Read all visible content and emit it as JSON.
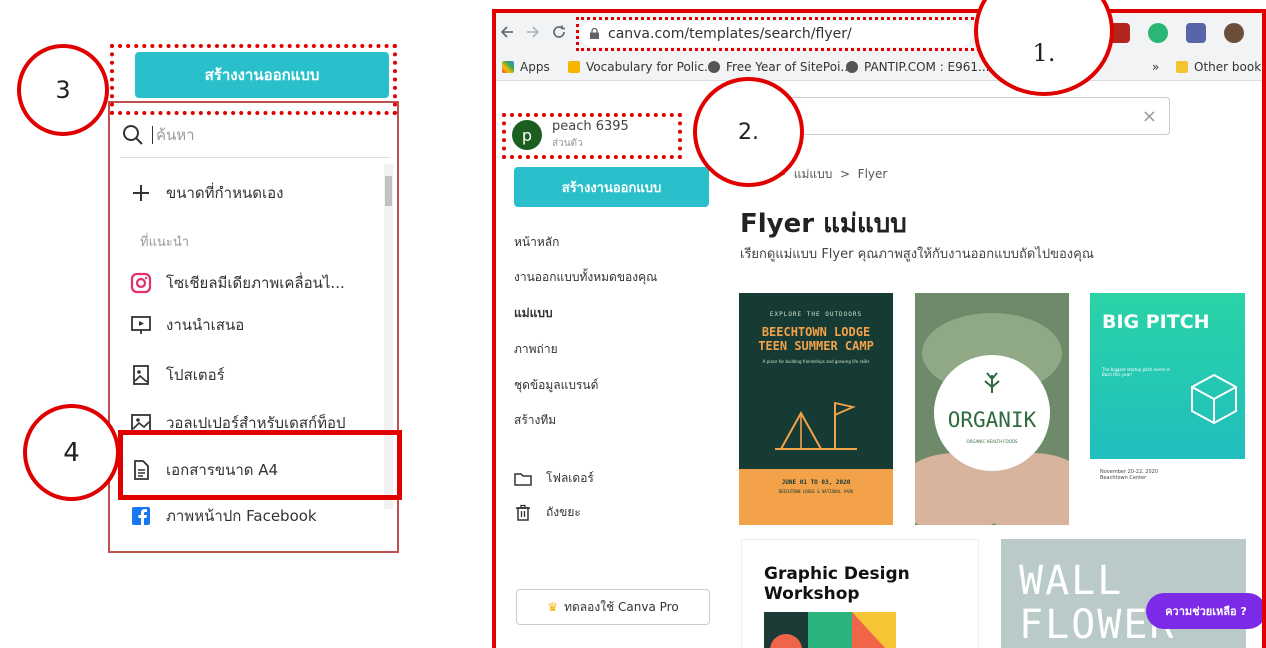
{
  "left_menu": {
    "create_label": "สร้างงานออกแบบ",
    "search_placeholder": "ค้นหา",
    "custom_size_label": "ขนาดที่กำหนดเอง",
    "suggested_heading": "ที่แนะนำ",
    "items": [
      {
        "label": "โซเชียลมีเดียภาพเคลื่อนไ...",
        "icon": "instagram-icon"
      },
      {
        "label": "งานนำเสนอ",
        "icon": "presentation-icon"
      },
      {
        "label": "โปสเตอร์",
        "icon": "poster-icon"
      },
      {
        "label": "วอลเปเปอร์สำหรับเดสก์ท็อป",
        "icon": "wallpaper-icon"
      },
      {
        "label": "เอกสารขนาด A4",
        "icon": "document-icon"
      },
      {
        "label": "ภาพหน้าปก Facebook",
        "icon": "facebook-icon"
      }
    ]
  },
  "annotations": {
    "step1": "1.",
    "step2": "2.",
    "step3": "3",
    "step4": "4"
  },
  "browser": {
    "url": "canva.com/templates/search/flyer/",
    "bookmarks": [
      {
        "label": "Apps"
      },
      {
        "label": "Vocabulary for Polic..."
      },
      {
        "label": "Free Year of SitePoi..."
      },
      {
        "label": "PANTIP.COM : E961..."
      },
      {
        "label": "»"
      },
      {
        "label": "Other bookmarks"
      }
    ]
  },
  "sidebar": {
    "user_initial": "p",
    "user_name": "peach 6395",
    "user_sub": "ส่วนตัว",
    "create_label": "สร้างงานออกแบบ",
    "links": [
      {
        "label": "หน้าหลัก"
      },
      {
        "label": "งานออกแบบทั้งหมดของคุณ"
      },
      {
        "label": "แม่แบบ"
      },
      {
        "label": "ภาพถ่าย"
      },
      {
        "label": "ชุดข้อมูลแบรนด์"
      },
      {
        "label": "สร้างทีม"
      }
    ],
    "folders_label": "โฟลเดอร์",
    "trash_label": "ถังขยะ",
    "pro_label": "ทดลองใช้ Canva Pro"
  },
  "main": {
    "breadcrumb_parts": [
      "แม่แบบ",
      "Flyer"
    ],
    "breadcrumb_sep": ">",
    "title": "Flyer แม่แบบ",
    "subtitle": "เรียกดูแม่แบบ Flyer คุณภาพสูงให้กับงานออกแบบถัดไปของคุณ",
    "templates": {
      "t1_top": "EXPLORE THE OUTDOORS",
      "t1_title": "BEECHTOWN LODGE TEEN SUMMER CAMP",
      "t1_desc": "A place for building friendships and growing life skills",
      "t1_date": "JUNE 01 TO 03, 2020",
      "t1_venue": "BEECHTOWN LODGE & NATIONAL PARK",
      "t2_title": "ORGANIK",
      "t2_sub": "ORGANIC HEALTH FOODS",
      "t3_title": "BIG PITCH",
      "t3_desc": "The biggest startup pitch event in Bach this year!",
      "t3_date": "November 20-22, 2020",
      "t3_venue": "Beachtown Center",
      "t4_title": "Graphic Design Workshop",
      "t5_title": "WALL FLOWER"
    },
    "help_label": "ความช่วยเหลือ ?"
  },
  "colors": {
    "accent_teal": "#29c0cc",
    "annotation_red": "#e00000",
    "help_purple": "#7d2ae8"
  }
}
